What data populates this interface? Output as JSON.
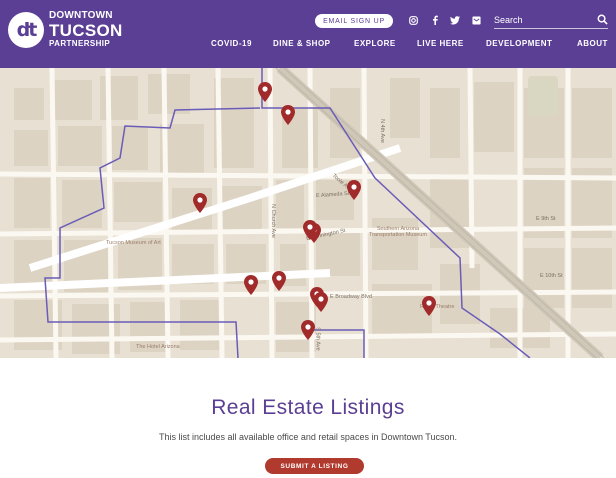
{
  "brand": {
    "line1": "DOWNTOWN",
    "line2": "TUCSON",
    "line3": "PARTNERSHIP",
    "mark": "dt",
    "color": "#5b3f94"
  },
  "header": {
    "email_signup": "EMAIL SIGN UP",
    "social_icons": [
      "instagram-icon",
      "facebook-icon",
      "twitter-icon",
      "email-icon"
    ],
    "search_placeholder": "Search"
  },
  "nav": {
    "items": [
      "COVID-19",
      "DINE & SHOP",
      "EXPLORE",
      "LIVE HERE",
      "DEVELOPMENT",
      "ABOUT"
    ]
  },
  "map": {
    "pin_color": "#a12a2a",
    "boundary_color": "#6a5cb8",
    "pin_count": 12,
    "streets": [
      "N Church Ave",
      "E Alameda St",
      "E Pennington St",
      "E Broadway Blvd",
      "Toole Ave",
      "E 9th St",
      "E 10th St",
      "S 5th Ave",
      "N 4th Ave"
    ],
    "places": [
      "Tucson Museum of Art",
      "Southern Arizona Transportation Museum",
      "Rialto Theatre",
      "The Hotel Arizona"
    ]
  },
  "content": {
    "title": "Real Estate Listings",
    "subtitle": "This list includes all available office and retail spaces in Downtown Tucson.",
    "submit_label": "SUBMIT A LISTING",
    "accent": "#b03a2e"
  }
}
